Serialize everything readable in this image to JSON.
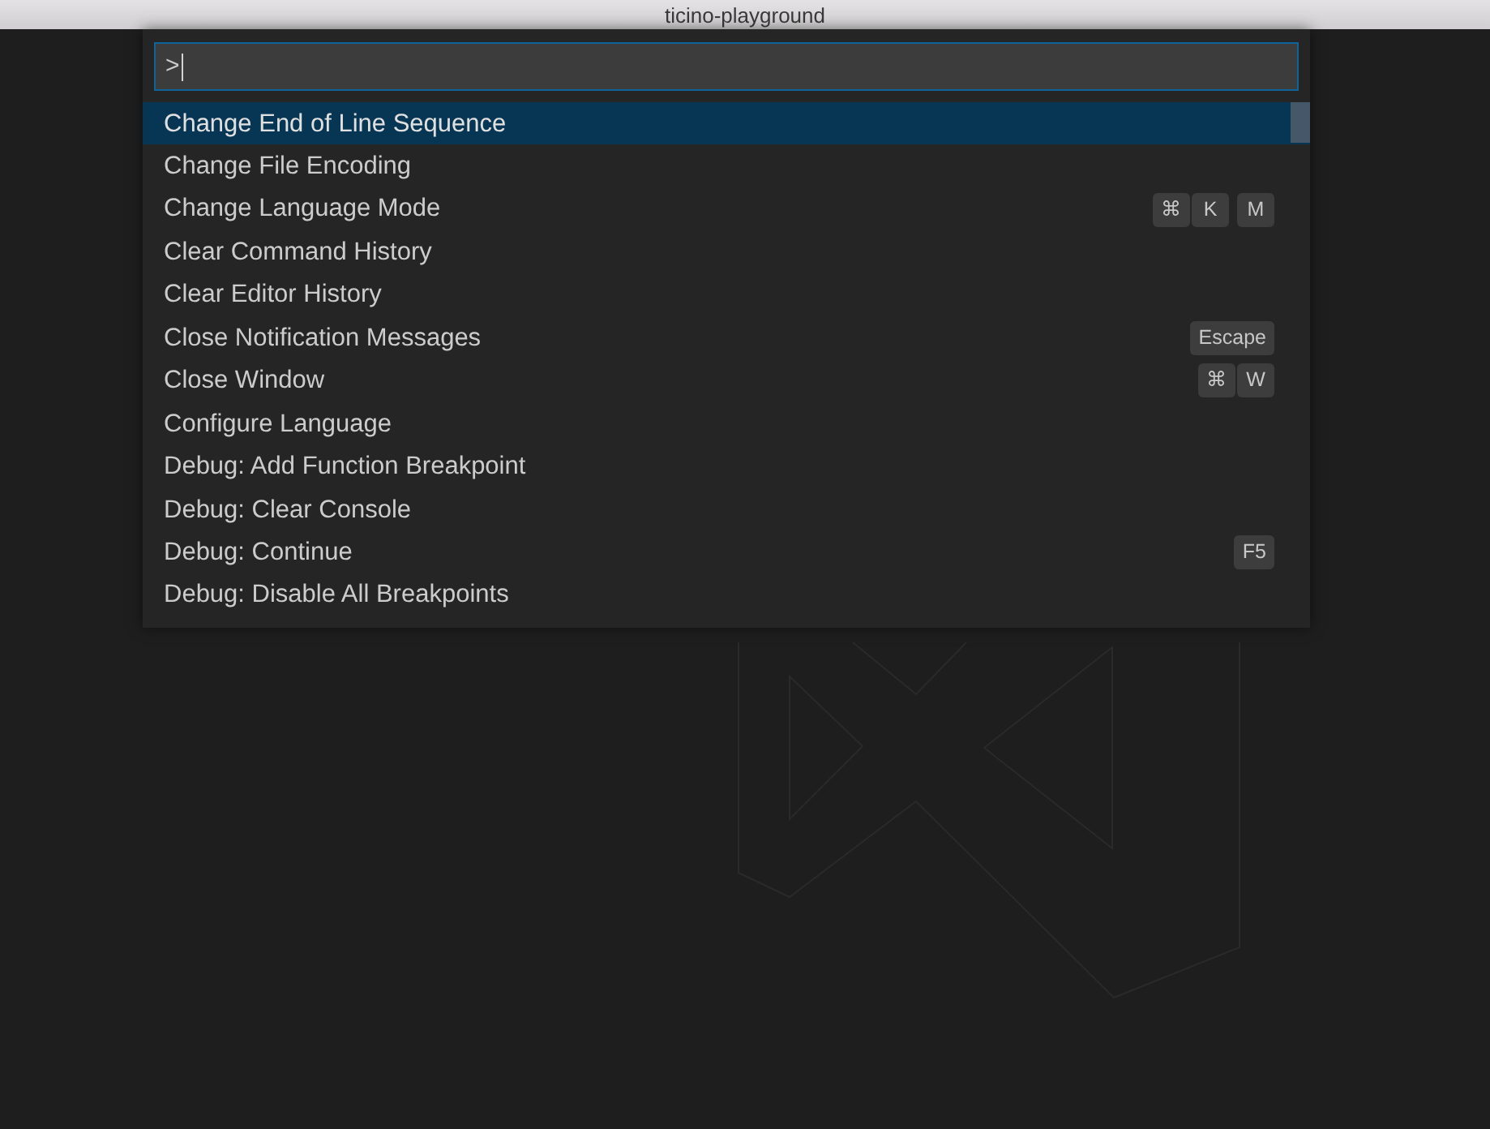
{
  "window": {
    "title": "ticino-playground"
  },
  "command_palette": {
    "input": {
      "value": ">",
      "focused": true
    },
    "items": [
      {
        "label": "Change End of Line Sequence",
        "selected": true
      },
      {
        "label": "Change File Encoding",
        "selected": false
      },
      {
        "label": "Change Language Mode",
        "selected": false,
        "keybinding": [
          [
            "⌘",
            "K"
          ],
          [
            "M"
          ]
        ]
      },
      {
        "label": "Clear Command History",
        "selected": false
      },
      {
        "label": "Clear Editor History",
        "selected": false
      },
      {
        "label": "Close Notification Messages",
        "selected": false,
        "keybinding": [
          [
            "Escape"
          ]
        ]
      },
      {
        "label": "Close Window",
        "selected": false,
        "keybinding": [
          [
            "⌘",
            "W"
          ]
        ]
      },
      {
        "label": "Configure Language",
        "selected": false
      },
      {
        "label": "Debug: Add Function Breakpoint",
        "selected": false
      },
      {
        "label": "Debug: Clear Console",
        "selected": false
      },
      {
        "label": "Debug: Continue",
        "selected": false,
        "keybinding": [
          [
            "F5"
          ]
        ]
      },
      {
        "label": "Debug: Disable All Breakpoints",
        "selected": false
      }
    ]
  }
}
